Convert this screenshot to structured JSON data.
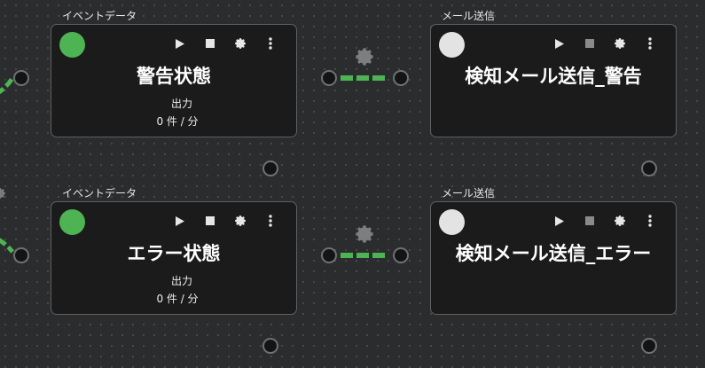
{
  "nodes": [
    {
      "type_label": "イベントデータ",
      "title": "警告状態",
      "output_label": "出力",
      "output_rate": "0 件 / 分",
      "status": "green"
    },
    {
      "type_label": "メール送信",
      "title": "検知メール送信_警告",
      "status": "white"
    },
    {
      "type_label": "イベントデータ",
      "title": "エラー状態",
      "output_label": "出力",
      "output_rate": "0 件 / 分",
      "status": "green"
    },
    {
      "type_label": "メール送信",
      "title": "検知メール送信_エラー",
      "status": "white"
    }
  ],
  "toolbar_icons": [
    "play-icon",
    "stop-icon",
    "gear-icon",
    "more-vertical-icon"
  ],
  "colors": {
    "active": "#4db353",
    "inactive": "#e3e3e3",
    "canvas": "#2b2c2e",
    "node_bg": "#1b1b1c"
  }
}
